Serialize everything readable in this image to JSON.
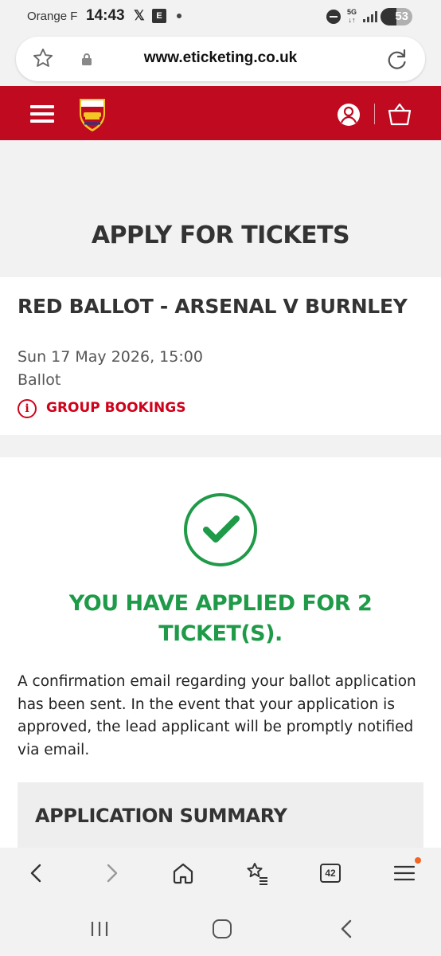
{
  "status_bar": {
    "carrier": "Orange F",
    "time": "14:43",
    "x_app": "𝕏",
    "notif_app": "E",
    "network": "5G",
    "battery": "53"
  },
  "browser": {
    "url": "www.eticketing.co.uk",
    "tab_count": "42"
  },
  "site_header": {
    "brand": "Arsenal",
    "accent_color": "#c00a20"
  },
  "page": {
    "title": "APPLY FOR TICKETS"
  },
  "event": {
    "title": "RED BALLOT - ARSENAL V BURNLEY",
    "date": "Sun 17 May 2026, 15:00",
    "type": "Ballot",
    "group_link": "GROUP BOOKINGS"
  },
  "confirmation": {
    "headline": "YOU HAVE APPLIED FOR 2 TICKET(S).",
    "body": "A confirmation email regarding your ballot application has been sent. In the event that your application is approved, the lead applicant will be promptly notified via email.",
    "summary_title": "APPLICATION SUMMARY",
    "success_color": "#1f9a48"
  },
  "icons": {
    "toolbar": [
      "back-icon",
      "forward-icon",
      "home-icon",
      "bookmarks-icon",
      "tabs-icon",
      "menu-icon"
    ],
    "nav": [
      "recents-icon",
      "home-icon",
      "back-icon"
    ]
  }
}
